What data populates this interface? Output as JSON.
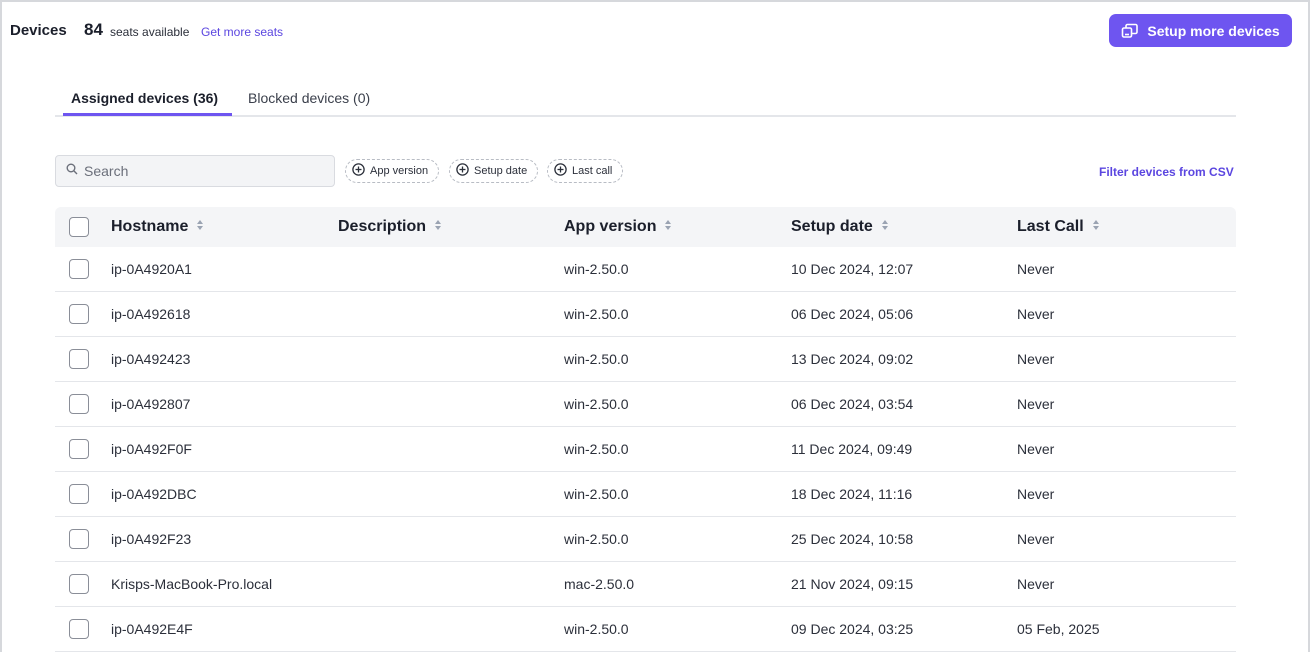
{
  "header": {
    "title": "Devices",
    "seat_count": "84",
    "seats_label": "seats available",
    "get_more_link": "Get more seats",
    "setup_button": "Setup more devices"
  },
  "tabs": [
    {
      "label": "Assigned devices (36)",
      "active": true
    },
    {
      "label": "Blocked devices (0)",
      "active": false
    }
  ],
  "filters": {
    "search_placeholder": "Search",
    "chips": [
      "App version",
      "Setup date",
      "Last call"
    ],
    "csv_link": "Filter devices from CSV"
  },
  "table": {
    "columns": [
      "Hostname",
      "Description",
      "App version",
      "Setup date",
      "Last Call"
    ],
    "rows": [
      {
        "hostname": "ip-0A4920A1",
        "description": "",
        "app_version": "win-2.50.0",
        "setup_date": "10 Dec 2024, 12:07",
        "last_call": "Never"
      },
      {
        "hostname": "ip-0A492618",
        "description": "",
        "app_version": "win-2.50.0",
        "setup_date": "06 Dec 2024, 05:06",
        "last_call": "Never"
      },
      {
        "hostname": "ip-0A492423",
        "description": "",
        "app_version": "win-2.50.0",
        "setup_date": "13 Dec 2024, 09:02",
        "last_call": "Never"
      },
      {
        "hostname": "ip-0A492807",
        "description": "",
        "app_version": "win-2.50.0",
        "setup_date": "06 Dec 2024, 03:54",
        "last_call": "Never"
      },
      {
        "hostname": "ip-0A492F0F",
        "description": "",
        "app_version": "win-2.50.0",
        "setup_date": "11 Dec 2024, 09:49",
        "last_call": "Never"
      },
      {
        "hostname": "ip-0A492DBC",
        "description": "",
        "app_version": "win-2.50.0",
        "setup_date": "18 Dec 2024, 11:16",
        "last_call": "Never"
      },
      {
        "hostname": "ip-0A492F23",
        "description": "",
        "app_version": "win-2.50.0",
        "setup_date": "25 Dec 2024, 10:58",
        "last_call": "Never"
      },
      {
        "hostname": "Krisps-MacBook-Pro.local",
        "description": "",
        "app_version": "mac-2.50.0",
        "setup_date": "21 Nov 2024, 09:15",
        "last_call": "Never"
      },
      {
        "hostname": "ip-0A492E4F",
        "description": "",
        "app_version": "win-2.50.0",
        "setup_date": "09 Dec 2024, 03:25",
        "last_call": "05 Feb, 2025"
      }
    ]
  },
  "colors": {
    "accent": "#6e55f0",
    "link": "#5b46e0"
  }
}
